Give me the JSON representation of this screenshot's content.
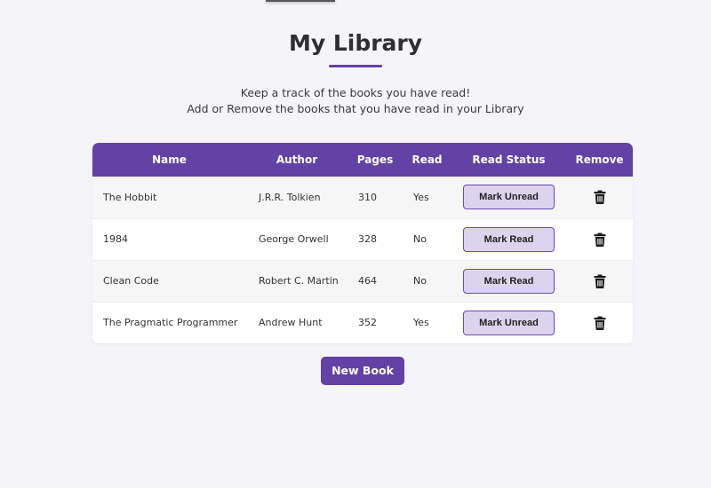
{
  "page": {
    "title": "My Library",
    "subtitle_line1": "Keep a track of the books you have read!",
    "subtitle_line2": "Add or Remove the books that you have read in your Library"
  },
  "colors": {
    "accent": "#6441a5",
    "button_bg": "#dcd4ee",
    "page_bg": "#f5f4f9"
  },
  "table": {
    "headers": {
      "name": "Name",
      "author": "Author",
      "pages": "Pages",
      "read": "Read",
      "read_status": "Read Status",
      "remove": "Remove"
    },
    "rows": [
      {
        "name": "The Hobbit",
        "author": "J.R.R. Tolkien",
        "pages": "310",
        "read": "Yes",
        "status_button": "Mark Unread",
        "remove_icon": "trash-icon"
      },
      {
        "name": "1984",
        "author": "George Orwell",
        "pages": "328",
        "read": "No",
        "status_button": "Mark Read",
        "remove_icon": "trash-icon"
      },
      {
        "name": "Clean Code",
        "author": "Robert C. Martin",
        "pages": "464",
        "read": "No",
        "status_button": "Mark Read",
        "remove_icon": "trash-icon"
      },
      {
        "name": "The Pragmatic Programmer",
        "author": "Andrew Hunt",
        "pages": "352",
        "read": "Yes",
        "status_button": "Mark Unread",
        "remove_icon": "trash-icon"
      }
    ]
  },
  "actions": {
    "new_book_label": "New Book"
  }
}
